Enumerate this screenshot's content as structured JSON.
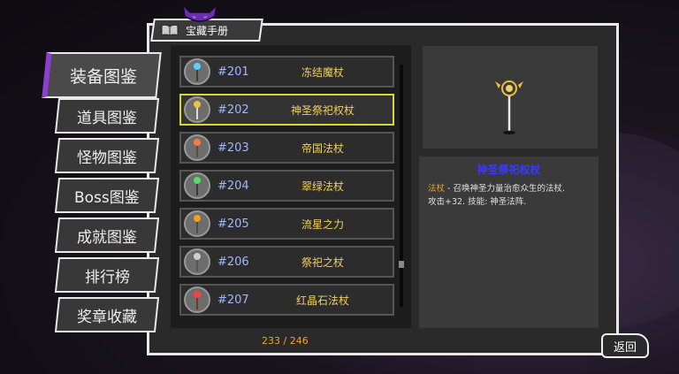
{
  "title": "宝藏手册",
  "side_menu": [
    {
      "label": "装备图鉴",
      "active": true
    },
    {
      "label": "道具图鉴",
      "active": false
    },
    {
      "label": "怪物图鉴",
      "active": false
    },
    {
      "label": "Boss图鉴",
      "active": false
    },
    {
      "label": "成就图鉴",
      "active": false
    },
    {
      "label": "排行榜",
      "active": false
    },
    {
      "label": "奖章收藏",
      "active": false
    }
  ],
  "items": [
    {
      "num": "#201",
      "name": "冻结魔杖",
      "selected": false,
      "gem": "#5ad0ff"
    },
    {
      "num": "#202",
      "name": "神圣祭祀权杖",
      "selected": true,
      "gem": "#f0c040"
    },
    {
      "num": "#203",
      "name": "帝国法杖",
      "selected": false,
      "gem": "#ff7a3a"
    },
    {
      "num": "#204",
      "name": "翠绿法杖",
      "selected": false,
      "gem": "#55dd66"
    },
    {
      "num": "#205",
      "name": "流星之力",
      "selected": false,
      "gem": "#f0a020"
    },
    {
      "num": "#206",
      "name": "祭祀之杖",
      "selected": false,
      "gem": "#d0d0d0"
    },
    {
      "num": "#207",
      "name": "红晶石法杖",
      "selected": false,
      "gem": "#ff4040"
    }
  ],
  "page_counter": "233 / 246",
  "detail": {
    "title": "神圣祭祀权杖",
    "type": "法杖",
    "desc_line1": " - 召唤神圣力量治愈众生的法杖.",
    "desc_line2": "攻击+32. 技能: 神圣法阵."
  },
  "back_label": "返回",
  "colors": {
    "accent": "#8a3fd0",
    "selected_border": "#d8d830",
    "item_name": "#f0d060",
    "item_num": "#9fb8ff"
  }
}
